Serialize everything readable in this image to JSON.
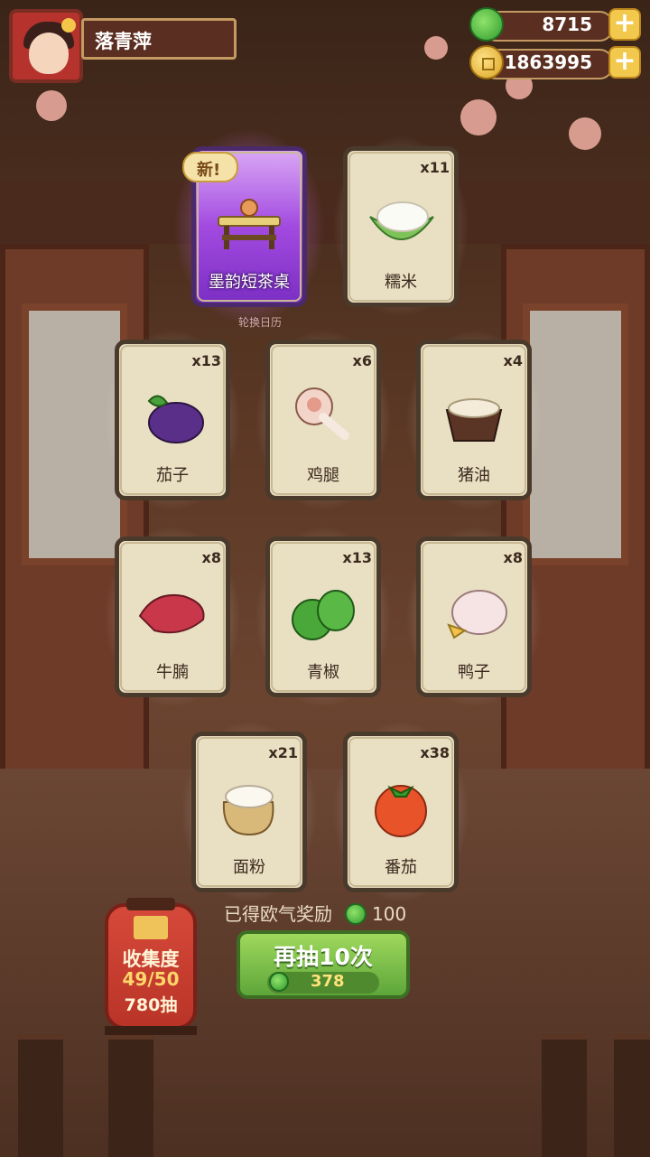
{
  "player": {
    "name": "落青萍"
  },
  "currencies": {
    "jade": {
      "value": "8715",
      "icon": "jade-icon"
    },
    "coin": {
      "value": "1863995",
      "icon": "coin-icon"
    }
  },
  "new_badge": "新!",
  "background_text": "轮换日历",
  "cards": [
    {
      "name": "墨韵短茶桌",
      "qty": "",
      "is_new": true
    },
    {
      "name": "糯米",
      "qty": "x11",
      "is_new": false
    },
    {
      "name": "茄子",
      "qty": "x13",
      "is_new": false
    },
    {
      "name": "鸡腿",
      "qty": "x6",
      "is_new": false
    },
    {
      "name": "猪油",
      "qty": "x4",
      "is_new": false
    },
    {
      "name": "牛腩",
      "qty": "x8",
      "is_new": false
    },
    {
      "name": "青椒",
      "qty": "x13",
      "is_new": false
    },
    {
      "name": "鸭子",
      "qty": "x8",
      "is_new": false
    },
    {
      "name": "面粉",
      "qty": "x21",
      "is_new": false
    },
    {
      "name": "番茄",
      "qty": "x38",
      "is_new": false
    }
  ],
  "reward": {
    "label": "已得欧气奖励",
    "value": "100"
  },
  "collection": {
    "title": "收集度",
    "progress": "49/50",
    "draws": "780抽"
  },
  "draw_button": {
    "label": "再抽10次",
    "cost": "378"
  },
  "colors": {
    "accent_green": "#5da63a",
    "purple_glow": "#a24ae0",
    "card_bg": "#e9dfc3"
  }
}
